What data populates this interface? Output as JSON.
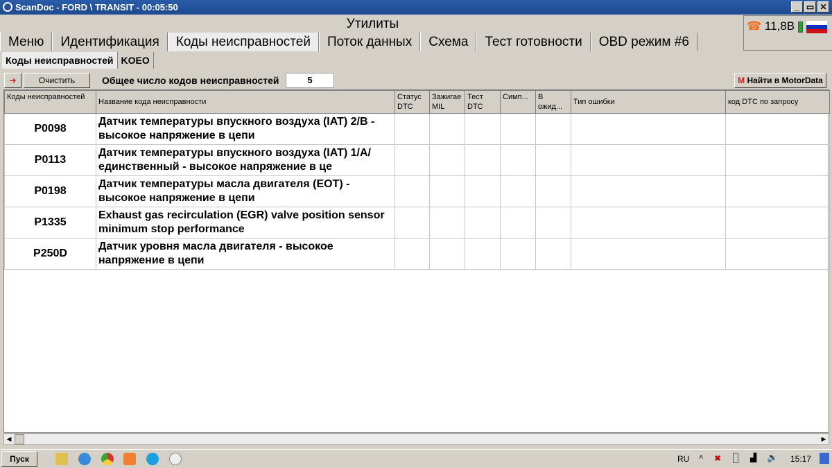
{
  "window": {
    "title": "ScanDoc - FORD \\ TRANSIT - 00:05:50",
    "minimize": "_",
    "restore": "▭",
    "close": "✕"
  },
  "header": {
    "title": "Утилиты",
    "voltage": "11,8В"
  },
  "tabs": [
    "Меню",
    "Идентификация",
    "Коды неисправностей",
    "Поток данных",
    "Схема",
    "Тест готовности",
    "OBD режим #6"
  ],
  "subtabs": [
    "Коды неисправностей",
    "KOEO"
  ],
  "toolbar": {
    "clear": "Очистить",
    "count_label": "Общее число кодов неисправностей",
    "count": "5",
    "motordata": "Найти в MotorData"
  },
  "columns": [
    "Коды неисправностей",
    "Название кода неисправности",
    "Статус DTC",
    "Зажигае MIL",
    "Тест DTC",
    "Симп...",
    "В ожид...",
    "Тип ошибки",
    "код DTC по запросу"
  ],
  "rows": [
    {
      "code": "P0098",
      "name": "Датчик температуры впускного воздуха (IAT) 2/B - высокое напряжение в цепи"
    },
    {
      "code": "P0113",
      "name": "Датчик температуры впускного воздуха (IAT) 1/A/единственный - высокое напряжение в це"
    },
    {
      "code": "P0198",
      "name": "Датчик температуры масла двигателя (EOT) - высокое напряжение в цепи"
    },
    {
      "code": "P1335",
      "name": "Exhaust gas recirculation (EGR) valve position sensor minimum stop performance"
    },
    {
      "code": "P250D",
      "name": "Датчик уровня масла двигателя - высокое напряжение в цепи"
    }
  ],
  "taskbar": {
    "start": "Пуск",
    "lang": "RU",
    "time": "15:17"
  }
}
